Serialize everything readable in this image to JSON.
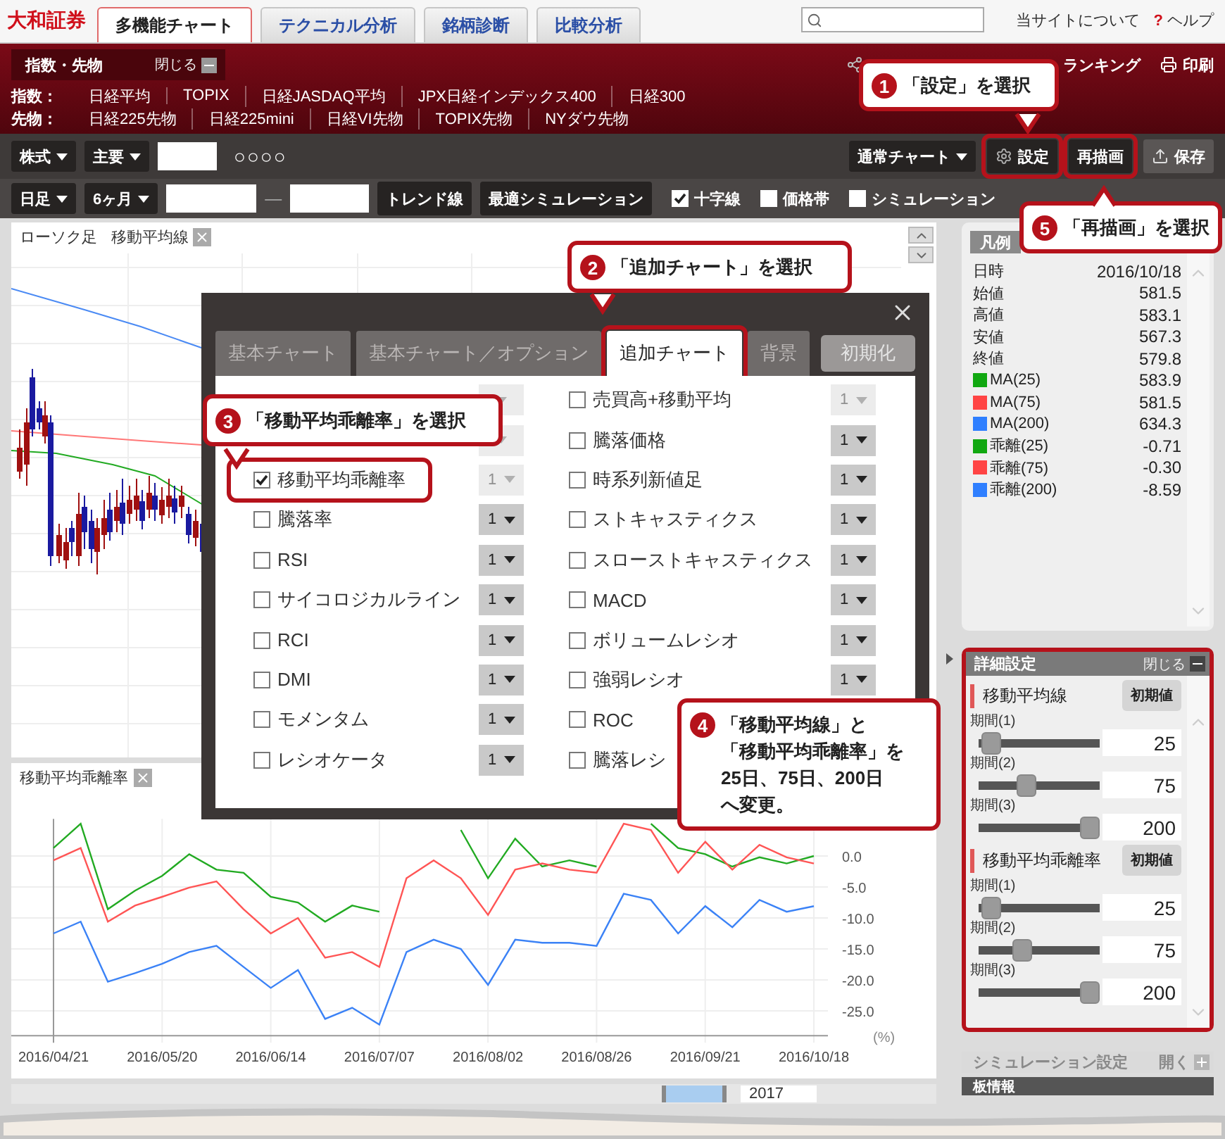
{
  "header": {
    "logo": "大和証券",
    "tabs": [
      {
        "label": "多機能チャート",
        "selected": true
      },
      {
        "label": "テクニカル分析",
        "selected": false
      },
      {
        "label": "銘柄診断",
        "selected": false
      },
      {
        "label": "比較分析",
        "selected": false
      }
    ],
    "links": [
      {
        "label": "当サイトについて"
      },
      {
        "label": "ヘルプ",
        "mark": "?"
      }
    ]
  },
  "index_bar": {
    "tab": "指数・先物",
    "close": "閉じる",
    "right_links": [
      "ランキング",
      "印刷"
    ],
    "rows": [
      {
        "label": "指数：",
        "items": [
          "日経平均",
          "TOPIX",
          "日経JASDAQ平均",
          "JPX日経インデックス400",
          "日経300"
        ]
      },
      {
        "label": "先物：",
        "items": [
          "日経225先物",
          "日経225mini",
          "日経VI先物",
          "TOPIX先物",
          "NYダウ先物"
        ]
      }
    ]
  },
  "toolbar": {
    "market": "株式",
    "category": "主要",
    "name": "○○○○",
    "chart_type": "通常チャート",
    "buttons": [
      {
        "label": "設定",
        "kind": "settings",
        "highlighted": true
      },
      {
        "label": "再描画",
        "kind": "plain",
        "highlighted": true
      },
      {
        "label": "保存",
        "kind": "save",
        "highlighted": false
      }
    ]
  },
  "toolbar2": {
    "period": "日足",
    "range": "6ヶ月",
    "separator": "—",
    "buttons": [
      "トレンド線",
      "最適シミュレーション"
    ],
    "options": [
      {
        "label": "十字線",
        "checked": true
      },
      {
        "label": "価格帯",
        "checked": false
      },
      {
        "label": "シミュレーション",
        "checked": false
      }
    ]
  },
  "main_chart": {
    "labels": [
      "ローソク足",
      "移動平均線"
    ]
  },
  "sub_chart": {
    "title": "移動平均乖離率",
    "chart_data": {
      "type": "line",
      "categories": [
        "2016/04/21",
        null,
        null,
        null,
        "2016/05/20",
        null,
        null,
        null,
        "2016/06/14",
        null,
        null,
        null,
        "2016/07/07",
        null,
        null,
        null,
        "2016/08/02",
        null,
        null,
        null,
        "2016/08/26",
        null,
        null,
        null,
        "2016/09/21",
        null,
        null,
        null,
        "2016/10/18"
      ],
      "ylim": [
        -29,
        6
      ],
      "grid": true,
      "yticks": [
        {
          "value": 0,
          "label": "0.0"
        },
        {
          "value": -5,
          "label": "-5.0"
        },
        {
          "value": -10,
          "label": "-10.0"
        },
        {
          "value": -15,
          "label": "-15.0"
        },
        {
          "value": -20,
          "label": "-20.0"
        },
        {
          "value": -25,
          "label": "-25.0"
        }
      ],
      "ylabel": "(%)",
      "series": [
        {
          "color": "#22aa22",
          "values": [
            1.3,
            5.2,
            -8.6,
            -5.6,
            -3.2,
            0.3,
            -2.2,
            -2.7,
            -6.6,
            -7.5,
            -10.6,
            -8.0,
            -9.0,
            null,
            null,
            4.2,
            -3.6,
            2.8,
            -1.7,
            -0.7,
            -1.7,
            null,
            5.2,
            1.3,
            0.3,
            -1.7,
            -0.2,
            -1.2,
            0.0
          ]
        },
        {
          "color": "#ff5555",
          "values": [
            -0.7,
            1.3,
            -10.6,
            -8.0,
            -6.6,
            -5.1,
            -4.1,
            -8.6,
            -12.5,
            -10.0,
            -16.4,
            -15.5,
            -17.9,
            -3.6,
            -0.7,
            -3.6,
            -9.5,
            -2.2,
            -1.2,
            -2.2,
            -2.7,
            5.2,
            4.2,
            -2.7,
            2.3,
            -2.2,
            1.8,
            -0.2,
            -1.2
          ]
        },
        {
          "color": "#3b82f6",
          "values": [
            -12.5,
            -10.6,
            -20.3,
            -18.9,
            -17.4,
            -15.5,
            -14.5,
            -17.9,
            -21.3,
            -18.4,
            -26.3,
            -24.5,
            -27.2,
            -15.5,
            -13.5,
            -15.0,
            -20.8,
            -13.5,
            -14.0,
            -14.0,
            -14.5,
            -6.1,
            -7.1,
            -12.5,
            -8.1,
            -11.5,
            -7.1,
            -9.0,
            -8.1
          ]
        }
      ]
    }
  },
  "timeline": {
    "year": "2017"
  },
  "dialog": {
    "tabs": [
      {
        "label": "基本チャート",
        "selected": false,
        "highlighted": false
      },
      {
        "label": "基本チャート／オプション",
        "selected": false,
        "highlighted": false
      },
      {
        "label": "追加チャート",
        "selected": true,
        "highlighted": true
      },
      {
        "label": "背景",
        "selected": false,
        "highlighted": false
      }
    ],
    "reset": "初期化",
    "left": [
      {
        "disabled": true
      },
      {
        "disabled": true
      },
      {
        "label": "移動平均乖離率",
        "checked": true,
        "count": "1",
        "disabled": true,
        "highlighted": true
      },
      {
        "label": "騰落率",
        "checked": false,
        "count": "1",
        "disabled": false
      },
      {
        "label": "RSI",
        "checked": false,
        "count": "1",
        "disabled": false
      },
      {
        "label": "サイコロジカルライン",
        "checked": false,
        "count": "1",
        "disabled": false
      },
      {
        "label": "RCI",
        "checked": false,
        "count": "1",
        "disabled": false
      },
      {
        "label": "DMI",
        "checked": false,
        "count": "1",
        "disabled": false
      },
      {
        "label": "モメンタム",
        "checked": false,
        "count": "1",
        "disabled": false
      },
      {
        "label": "レシオケータ",
        "checked": false,
        "count": "1",
        "disabled": false
      }
    ],
    "right": [
      {
        "label": "売買高+移動平均",
        "checked": false,
        "count": "1",
        "disabled": true
      },
      {
        "label": "騰落価格",
        "checked": false,
        "count": "1",
        "disabled": false
      },
      {
        "label": "時系列新値足",
        "checked": false,
        "count": "1",
        "disabled": false
      },
      {
        "label": "ストキャスティクス",
        "checked": false,
        "count": "1",
        "disabled": false
      },
      {
        "label": "スローストキャスティクス",
        "checked": false,
        "count": "1",
        "disabled": false
      },
      {
        "label": "MACD",
        "checked": false,
        "count": "1",
        "disabled": false
      },
      {
        "label": "ボリュームレシオ",
        "checked": false,
        "count": "1",
        "disabled": false
      },
      {
        "label": "強弱レシオ",
        "checked": false,
        "count": "1",
        "disabled": false
      },
      {
        "label": "ROC",
        "checked": false
      },
      {
        "label": "騰落レシ",
        "checked": false
      }
    ]
  },
  "legend": {
    "title": "凡例",
    "rows": [
      {
        "label": "日時",
        "value": "2016/10/18"
      },
      {
        "label": "始値",
        "value": "581.5"
      },
      {
        "label": "高値",
        "value": "583.1"
      },
      {
        "label": "安値",
        "value": "567.3"
      },
      {
        "label": "終値",
        "value": "579.8"
      },
      {
        "label": "MA(25)",
        "value": "583.9",
        "color": "#11a811"
      },
      {
        "label": "MA(75)",
        "value": "581.5",
        "color": "#ff4444"
      },
      {
        "label": "MA(200)",
        "value": "634.3",
        "color": "#2f7fff"
      },
      {
        "label": "乖離(25)",
        "value": "-0.71",
        "color": "#11a811"
      },
      {
        "label": "乖離(75)",
        "value": "-0.30",
        "color": "#ff4444"
      },
      {
        "label": "乖離(200)",
        "value": "-8.59",
        "color": "#2f7fff"
      }
    ]
  },
  "detail": {
    "title": "詳細設定",
    "close": "閉じる",
    "highlighted": true,
    "groups": [
      {
        "title": "移動平均線",
        "reset": "初期値",
        "periods": [
          {
            "label": "期間(1)",
            "value": "25",
            "level": 0.03
          },
          {
            "label": "期間(2)",
            "value": "75",
            "level": 0.37
          },
          {
            "label": "期間(3)",
            "value": "200",
            "level": 1
          }
        ]
      },
      {
        "title": "移動平均乖離率",
        "reset": "初期値",
        "periods": [
          {
            "label": "期間(1)",
            "value": "25",
            "level": 0.03
          },
          {
            "label": "期間(2)",
            "value": "75",
            "level": 0.33
          },
          {
            "label": "期間(3)",
            "value": "200",
            "level": 1
          }
        ]
      }
    ]
  },
  "simulation": {
    "title": "シミュレーション設定",
    "open": "開く"
  },
  "board": {
    "title": "板情報"
  },
  "callouts": [
    {
      "number": "1",
      "lines": [
        "「設定」を選択"
      ]
    },
    {
      "number": "2",
      "lines": [
        "「追加チャート」を選択"
      ]
    },
    {
      "number": "3",
      "lines": [
        "「移動平均乖離率」を選択"
      ]
    },
    {
      "number": "4",
      "lines": [
        "「移動平均線」と",
        "「移動平均乖離率」を",
        "25日、75日、200日",
        "へ変更。"
      ]
    },
    {
      "number": "5",
      "lines": [
        "「再描画」を選択"
      ]
    }
  ]
}
